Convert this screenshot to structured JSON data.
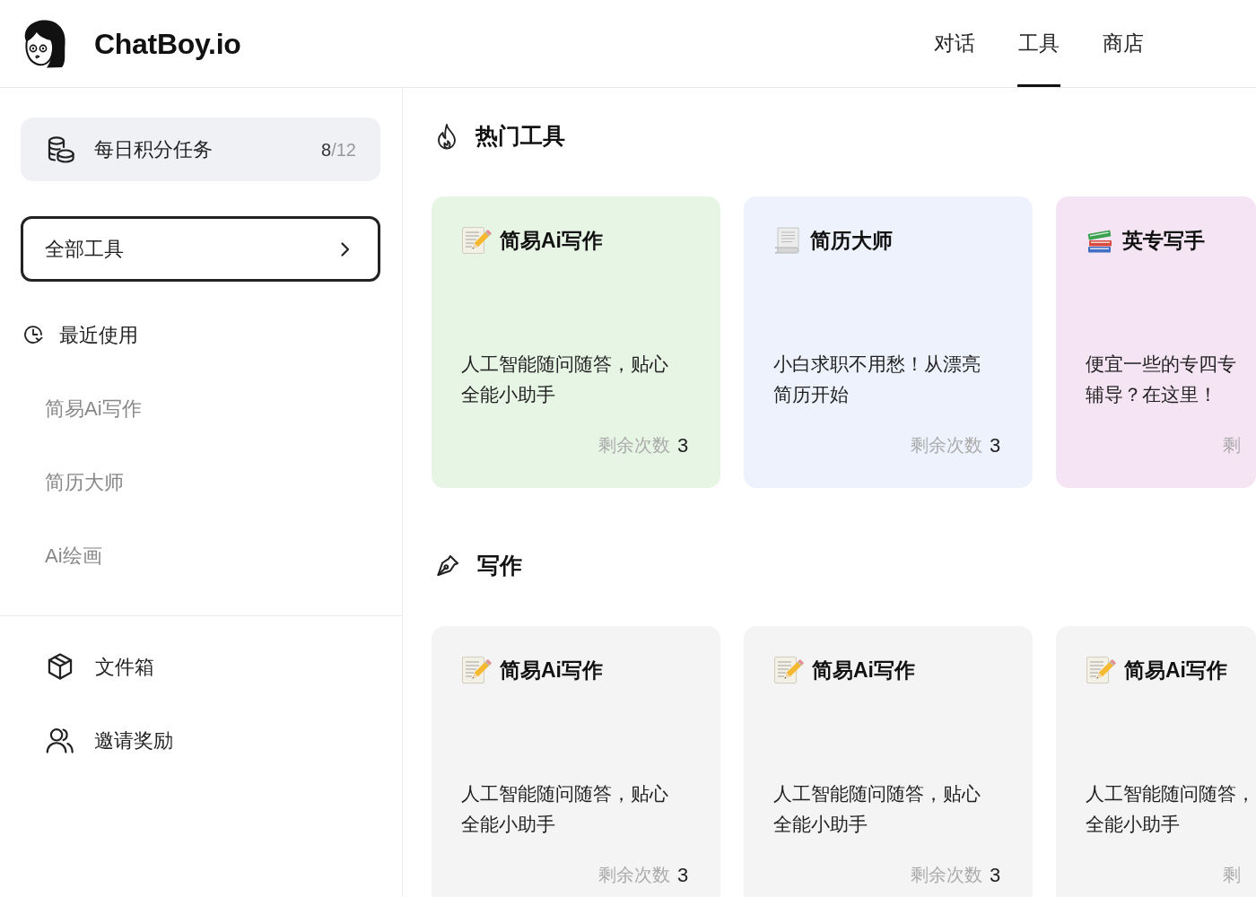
{
  "header": {
    "brand": "ChatBoy.io",
    "tabs": [
      {
        "label": "对话",
        "selected": false
      },
      {
        "label": "工具",
        "selected": true
      },
      {
        "label": "商店",
        "selected": false
      }
    ]
  },
  "sidebar": {
    "daily_task": {
      "label": "每日积分任务",
      "done": "8",
      "total": "/12"
    },
    "all_tools": {
      "label": "全部工具"
    },
    "recent": {
      "title": "最近使用",
      "items": [
        "简易Ai写作",
        "简历大师",
        "Ai绘画"
      ]
    },
    "links": [
      {
        "kind": "files",
        "label": "文件箱"
      },
      {
        "kind": "invite",
        "label": "邀请奖励"
      }
    ]
  },
  "sections": [
    {
      "kind": "hot",
      "title": "热门工具",
      "cards": [
        {
          "kind": "memo",
          "title": "简易Ai写作",
          "color": "#e7f5e4",
          "description": [
            "人工智能随问随答，贴心",
            "全能小助手"
          ],
          "remaining_label": "剩余次数",
          "remaining": "3"
        },
        {
          "kind": "page",
          "title": "简历大师",
          "color": "#eef2fd",
          "description": [
            "小白求职不用愁！从漂亮",
            "简历开始"
          ],
          "remaining_label": "剩余次数",
          "remaining": "3"
        },
        {
          "kind": "books",
          "title": "英专写手",
          "color": "#f5e4f3",
          "description": [
            "便宜一些的专四专",
            "辅导？在这里！"
          ],
          "remaining_label": "剩"
        }
      ]
    },
    {
      "kind": "writing",
      "title": "写作",
      "cards": [
        {
          "kind": "memo",
          "title": "简易Ai写作",
          "color": "#f4f4f4",
          "description": [
            "人工智能随问随答，贴心",
            "全能小助手"
          ],
          "remaining_label": "剩余次数",
          "remaining": "3"
        },
        {
          "kind": "memo",
          "title": "简易Ai写作",
          "color": "#f4f4f4",
          "description": [
            "人工智能随问随答，贴心",
            "全能小助手"
          ],
          "remaining_label": "剩余次数",
          "remaining": "3"
        },
        {
          "kind": "memo",
          "title": "简易Ai写作",
          "color": "#f4f4f4",
          "description": [
            "人工智能随问随答，",
            "全能小助手"
          ],
          "remaining_label": "剩"
        }
      ]
    }
  ]
}
